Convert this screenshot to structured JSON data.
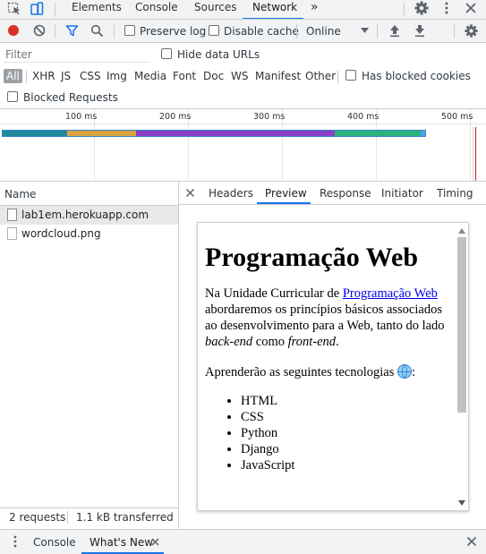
{
  "tabs": {
    "elements": "Elements",
    "console": "Console",
    "sources": "Sources",
    "network": "Network",
    "more": "»"
  },
  "toolbar": {
    "preserve_log": "Preserve log",
    "disable_cache": "Disable cache",
    "throttle": "Online"
  },
  "filter": {
    "placeholder": "Filter",
    "hide_data_urls": "Hide data URLs",
    "types": [
      "All",
      "XHR",
      "JS",
      "CSS",
      "Img",
      "Media",
      "Font",
      "Doc",
      "WS",
      "Manifest",
      "Other"
    ],
    "has_blocked_cookies": "Has blocked cookies",
    "blocked_requests": "Blocked Requests"
  },
  "timeline": {
    "ticks": [
      "100 ms",
      "200 ms",
      "300 ms",
      "400 ms",
      "500 ms"
    ]
  },
  "requests": {
    "header": "Name",
    "items": [
      "lab1em.herokuapp.com",
      "wordcloud.png"
    ]
  },
  "detail_tabs": [
    "Headers",
    "Preview",
    "Response",
    "Initiator",
    "Timing"
  ],
  "preview": {
    "title": "Programação Web",
    "p1_before": "Na Unidade Curricular de ",
    "p1_link": "Programação Web",
    "p1_middle": " abordaremos os princípios básicos associados ao desenvolvimento para a Web, tanto do lado ",
    "p1_em1": "back-end",
    "p1_between": " como ",
    "p1_em2": "front-end",
    "p1_end": ".",
    "p2": "Aprenderão as seguintes tecnologias ",
    "p2_end": ":",
    "techs": [
      "HTML",
      "CSS",
      "Python",
      "Django",
      "JavaScript"
    ]
  },
  "status": {
    "requests": "2 requests",
    "transferred": "1.1 kB transferred"
  },
  "drawer": {
    "console": "Console",
    "whats_new": "What's New"
  },
  "colors": {
    "accent": "#1a73e8",
    "record": "#d93025",
    "waterfall_ssl": "#1f8a9e",
    "waterfall_wait": "#d9a441",
    "waterfall_receive": "#8b3fc7",
    "waterfall_download": "#2ab37a",
    "waterfall_end": "#4aa3e8"
  }
}
